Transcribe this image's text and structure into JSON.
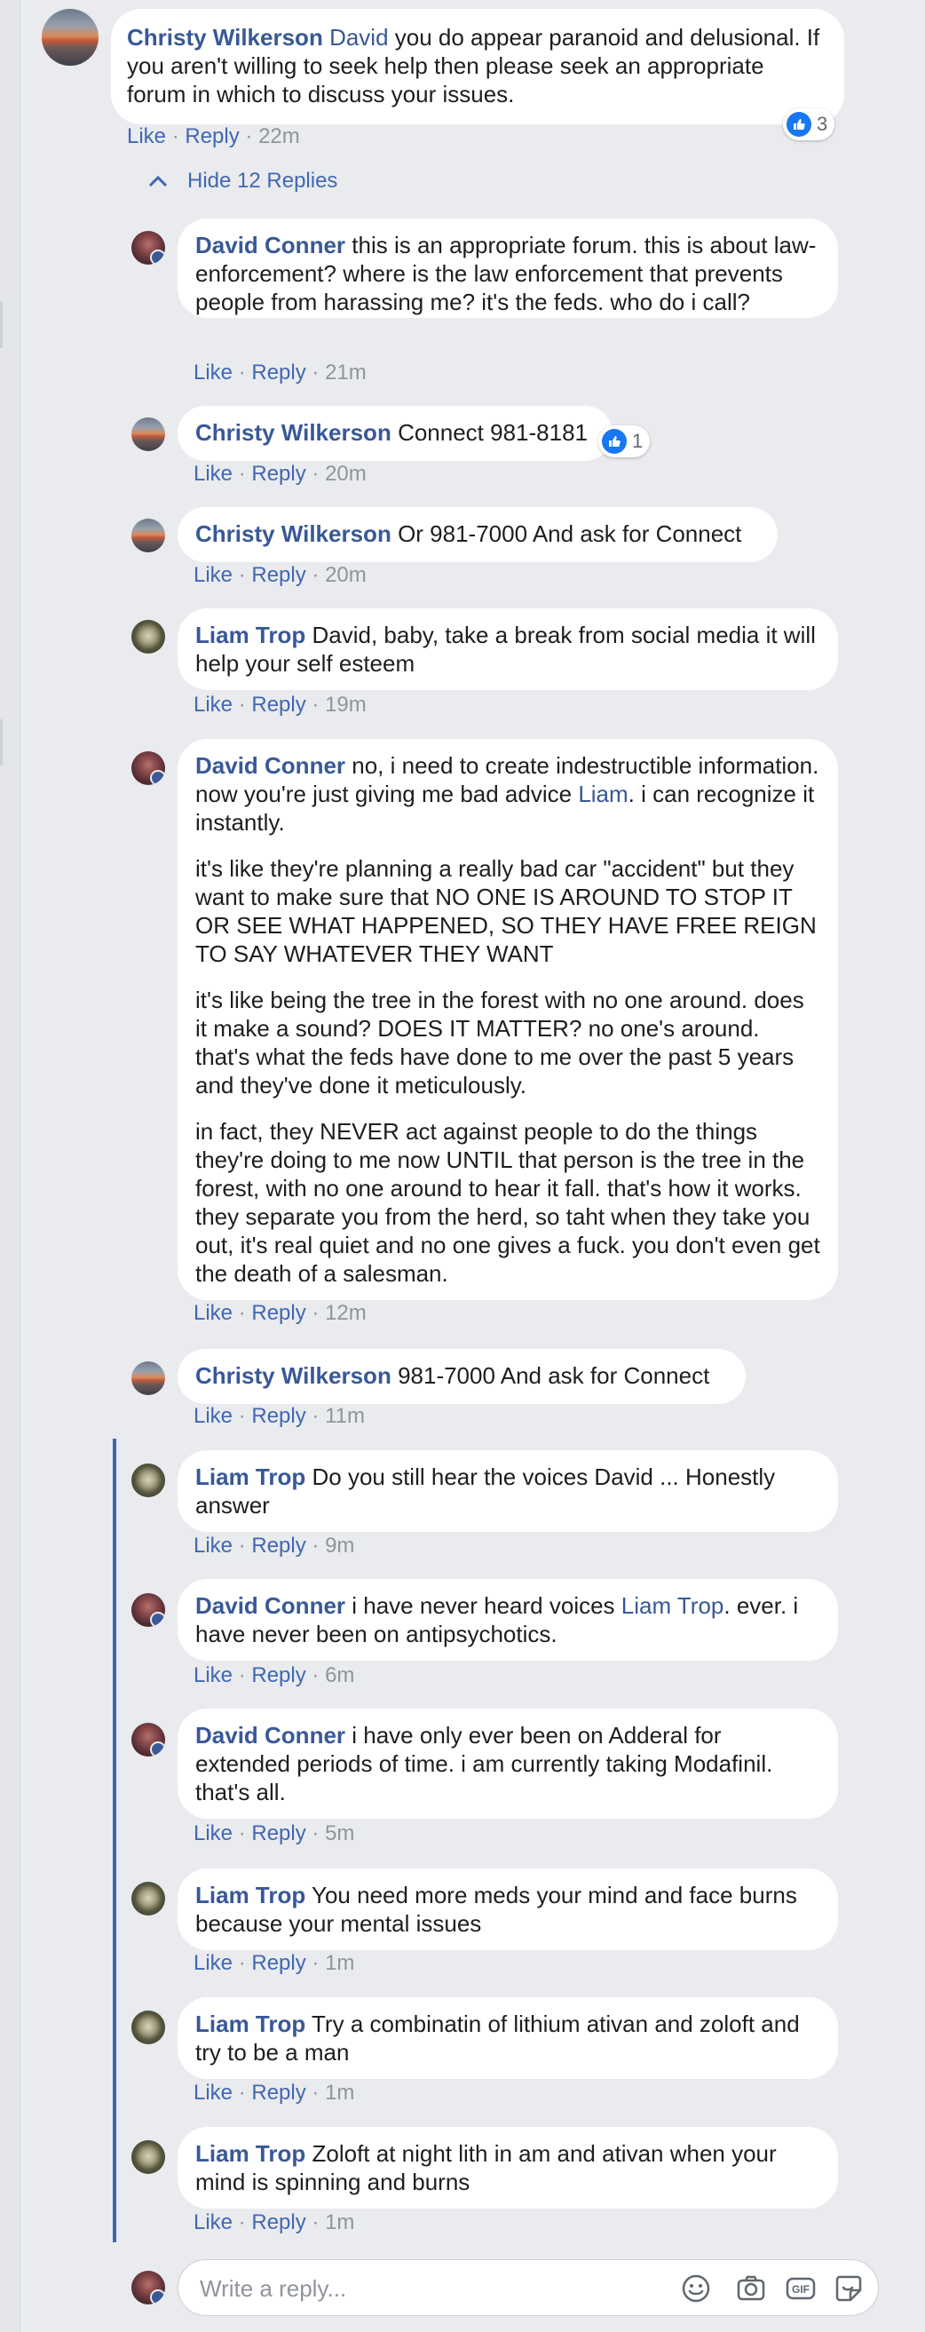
{
  "main_comment": {
    "author": "Christy Wilkerson",
    "mention": "David",
    "text": " you do appear paranoid and delusional. If you aren't willing to seek help then please seek an appropriate forum in which to discuss your issues.",
    "like_label": "Like",
    "reply_label": "Reply",
    "separator": "·",
    "time": "22m",
    "reaction_count": "3",
    "hide_replies_label": "Hide 12 Replies"
  },
  "replies": [
    {
      "author": "David Conner",
      "text": "this is an appropriate forum. this is about law-enforcement? where is the law enforcement that prevents people from harassing me? it's the feds. who do i call?",
      "time": "21m"
    },
    {
      "author": "Christy Wilkerson",
      "text": "Connect 981-8181",
      "time": "20m",
      "reaction_count": "1"
    },
    {
      "author": "Christy Wilkerson",
      "text": "Or 981-7000 And ask for Connect",
      "time": "20m"
    },
    {
      "author": "Liam Trop",
      "text": "David, baby, take a break from social media it will help your self esteem",
      "time": "19m"
    },
    {
      "author": "David Conner",
      "text_before_mention": "no, i need to create indestructible information. now you're just giving me bad advice ",
      "mention": "Liam",
      "text_after_mention": ". i can recognize it instantly.",
      "paragraphs": [
        "it's like they're planning a really bad car \"accident\" but they want to make sure that NO ONE IS AROUND TO STOP IT OR SEE WHAT HAPPENED, SO THEY HAVE FREE REIGN TO SAY WHATEVER THEY WANT",
        "it's like being the tree in the forest with no one around. does it make a sound? DOES IT MATTER? no one's around. that's what the feds have done to me over the past 5 years and they've done it meticulously.",
        "in fact, they NEVER act against people to do the things they're doing to me now UNTIL that person is the tree in the forest, with no one around to hear it fall. that's how it works. they separate you from the herd, so taht when they take you out, it's real quiet and no one gives a fuck. you don't even get the death of a salesman."
      ],
      "time": "12m"
    },
    {
      "author": "Christy Wilkerson",
      "text": "981-7000 And ask for Connect",
      "time": "11m"
    },
    {
      "author": "Liam Trop",
      "text": "Do you still hear the voices David ... Honestly answer",
      "time": "9m"
    },
    {
      "author": "David Conner",
      "text_before_mention": "i have never heard voices ",
      "mention": "Liam Trop",
      "text_after_mention": ". ever. i have never been on antipsychotics.",
      "time": "6m"
    },
    {
      "author": "David Conner",
      "text": "i have only ever been on Adderal for extended periods of time. i am currently taking Modafinil. that's all.",
      "time": "5m"
    },
    {
      "author": "Liam Trop",
      "text": "You need more meds your mind and face burns because your mental issues",
      "time": "1m"
    },
    {
      "author": "Liam Trop",
      "text": "Try a combinatin of lithium ativan and zoloft and try to be a man",
      "time": "1m"
    },
    {
      "author": "Liam Trop",
      "text": "Zoloft at night lith in am and ativan when your mind is spinning and burns",
      "time": "1m"
    }
  ],
  "reply_box": {
    "placeholder": "Write a reply...",
    "icons": [
      "emoji-icon",
      "camera-icon",
      "gif-icon",
      "sticker-icon"
    ]
  },
  "colors": {
    "accent": "#385898",
    "link": "#4267b2",
    "reaction_blue": "#1877f2",
    "background": "#e9ebee"
  }
}
